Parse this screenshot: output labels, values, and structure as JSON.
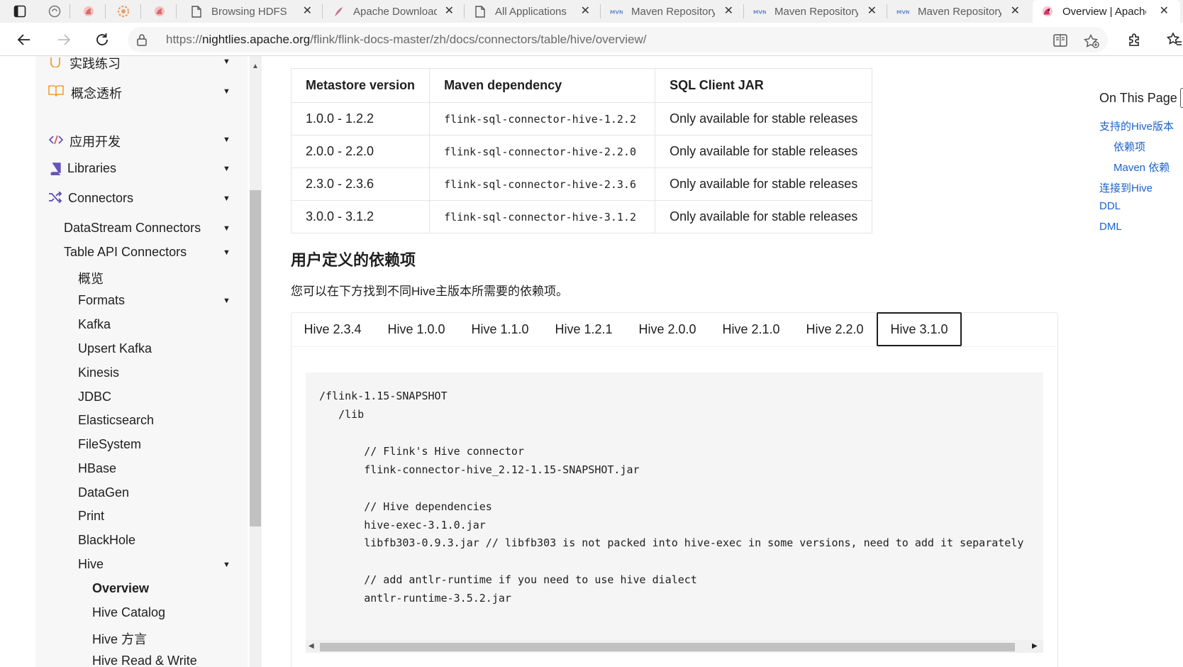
{
  "browser": {
    "tabs": [
      {
        "title": "Browsing HDFS",
        "favicon": "page-icon"
      },
      {
        "title": "Apache Downloads",
        "favicon": "apache-feather-icon"
      },
      {
        "title": "All Applications",
        "favicon": "page-icon"
      },
      {
        "title": "Maven Repository",
        "favicon": "mvn-icon"
      },
      {
        "title": "Maven Repository",
        "favicon": "mvn-icon"
      },
      {
        "title": "Maven Repository",
        "favicon": "mvn-icon"
      },
      {
        "title": "Overview | Apache Flink",
        "favicon": "flink-squirrel-icon",
        "active": true
      }
    ],
    "url": {
      "scheme": "https://",
      "host": "nightlies.apache.org",
      "path": "/flink/flink-docs-master/zh/docs/connectors/table/hive/overview/"
    }
  },
  "sidebar": {
    "items": [
      {
        "label": "实践练习",
        "icon": "practice-icon",
        "arrow": "▼"
      },
      {
        "label": "概念透析",
        "icon": "book-open-icon",
        "arrow": "▼"
      },
      {
        "label": "应用开发",
        "icon": "code-icon",
        "arrow": "▼"
      },
      {
        "label": "Libraries",
        "icon": "book-icon",
        "arrow": "▼"
      },
      {
        "label": "Connectors",
        "icon": "shuffle-icon",
        "arrow": "▼"
      },
      {
        "label": "DataStream Connectors",
        "arrow": "▼"
      },
      {
        "label": "Table API Connectors",
        "arrow": "▼"
      },
      {
        "label": "概览"
      },
      {
        "label": "Formats",
        "arrow": "▼"
      },
      {
        "label": "Kafka"
      },
      {
        "label": "Upsert Kafka"
      },
      {
        "label": "Kinesis"
      },
      {
        "label": "JDBC"
      },
      {
        "label": "Elasticsearch"
      },
      {
        "label": "FileSystem"
      },
      {
        "label": "HBase"
      },
      {
        "label": "DataGen"
      },
      {
        "label": "Print"
      },
      {
        "label": "BlackHole"
      },
      {
        "label": "Hive",
        "arrow": "▼"
      },
      {
        "label": "Overview",
        "active": true
      },
      {
        "label": "Hive Catalog"
      },
      {
        "label": "Hive 方言"
      },
      {
        "label": "Hive Read & Write"
      }
    ]
  },
  "main": {
    "table": {
      "headers": [
        "Metastore version",
        "Maven dependency",
        "SQL Client JAR"
      ],
      "rows": [
        [
          "1.0.0 - 1.2.2",
          "flink-sql-connector-hive-1.2.2",
          "Only available for stable releases"
        ],
        [
          "2.0.0 - 2.2.0",
          "flink-sql-connector-hive-2.2.0",
          "Only available for stable releases"
        ],
        [
          "2.3.0 - 2.3.6",
          "flink-sql-connector-hive-2.3.6",
          "Only available for stable releases"
        ],
        [
          "3.0.0 - 3.1.2",
          "flink-sql-connector-hive-3.1.2",
          "Only available for stable releases"
        ]
      ]
    },
    "section_title": "用户定义的依赖项",
    "section_text": "您可以在下方找到不同Hive主版本所需要的依赖项。",
    "version_tabs": [
      "Hive 2.3.4",
      "Hive 1.0.0",
      "Hive 1.1.0",
      "Hive 1.2.1",
      "Hive 2.0.0",
      "Hive 2.1.0",
      "Hive 2.2.0",
      "Hive 3.1.0"
    ],
    "active_version_tab": "Hive 3.1.0",
    "code_lines": [
      "/flink-1.15-SNAPSHOT",
      "   /lib",
      "",
      "       // Flink's Hive connector",
      "       flink-connector-hive_2.12-1.15-SNAPSHOT.jar",
      "",
      "       // Hive dependencies",
      "       hive-exec-3.1.0.jar",
      "       libfb303-0.9.3.jar // libfb303 is not packed into hive-exec in some versions, need to add it separately",
      "",
      "       // add antlr-runtime if you need to use hive dialect",
      "       antlr-runtime-3.5.2.jar"
    ]
  },
  "toc": {
    "title": "On This Page",
    "links": [
      {
        "label": "支持的Hive版本",
        "level": 1
      },
      {
        "label": "依赖项",
        "level": 2
      },
      {
        "label": "Maven 依赖",
        "level": 2
      },
      {
        "label": "连接到Hive",
        "level": 1
      },
      {
        "label": "DDL",
        "level": 1
      },
      {
        "label": "DML",
        "level": 1
      }
    ]
  },
  "colors": {
    "link": "#1a63c7",
    "connectors_icon": "#5b4bb7",
    "practice_icon": "#f0a12b"
  }
}
